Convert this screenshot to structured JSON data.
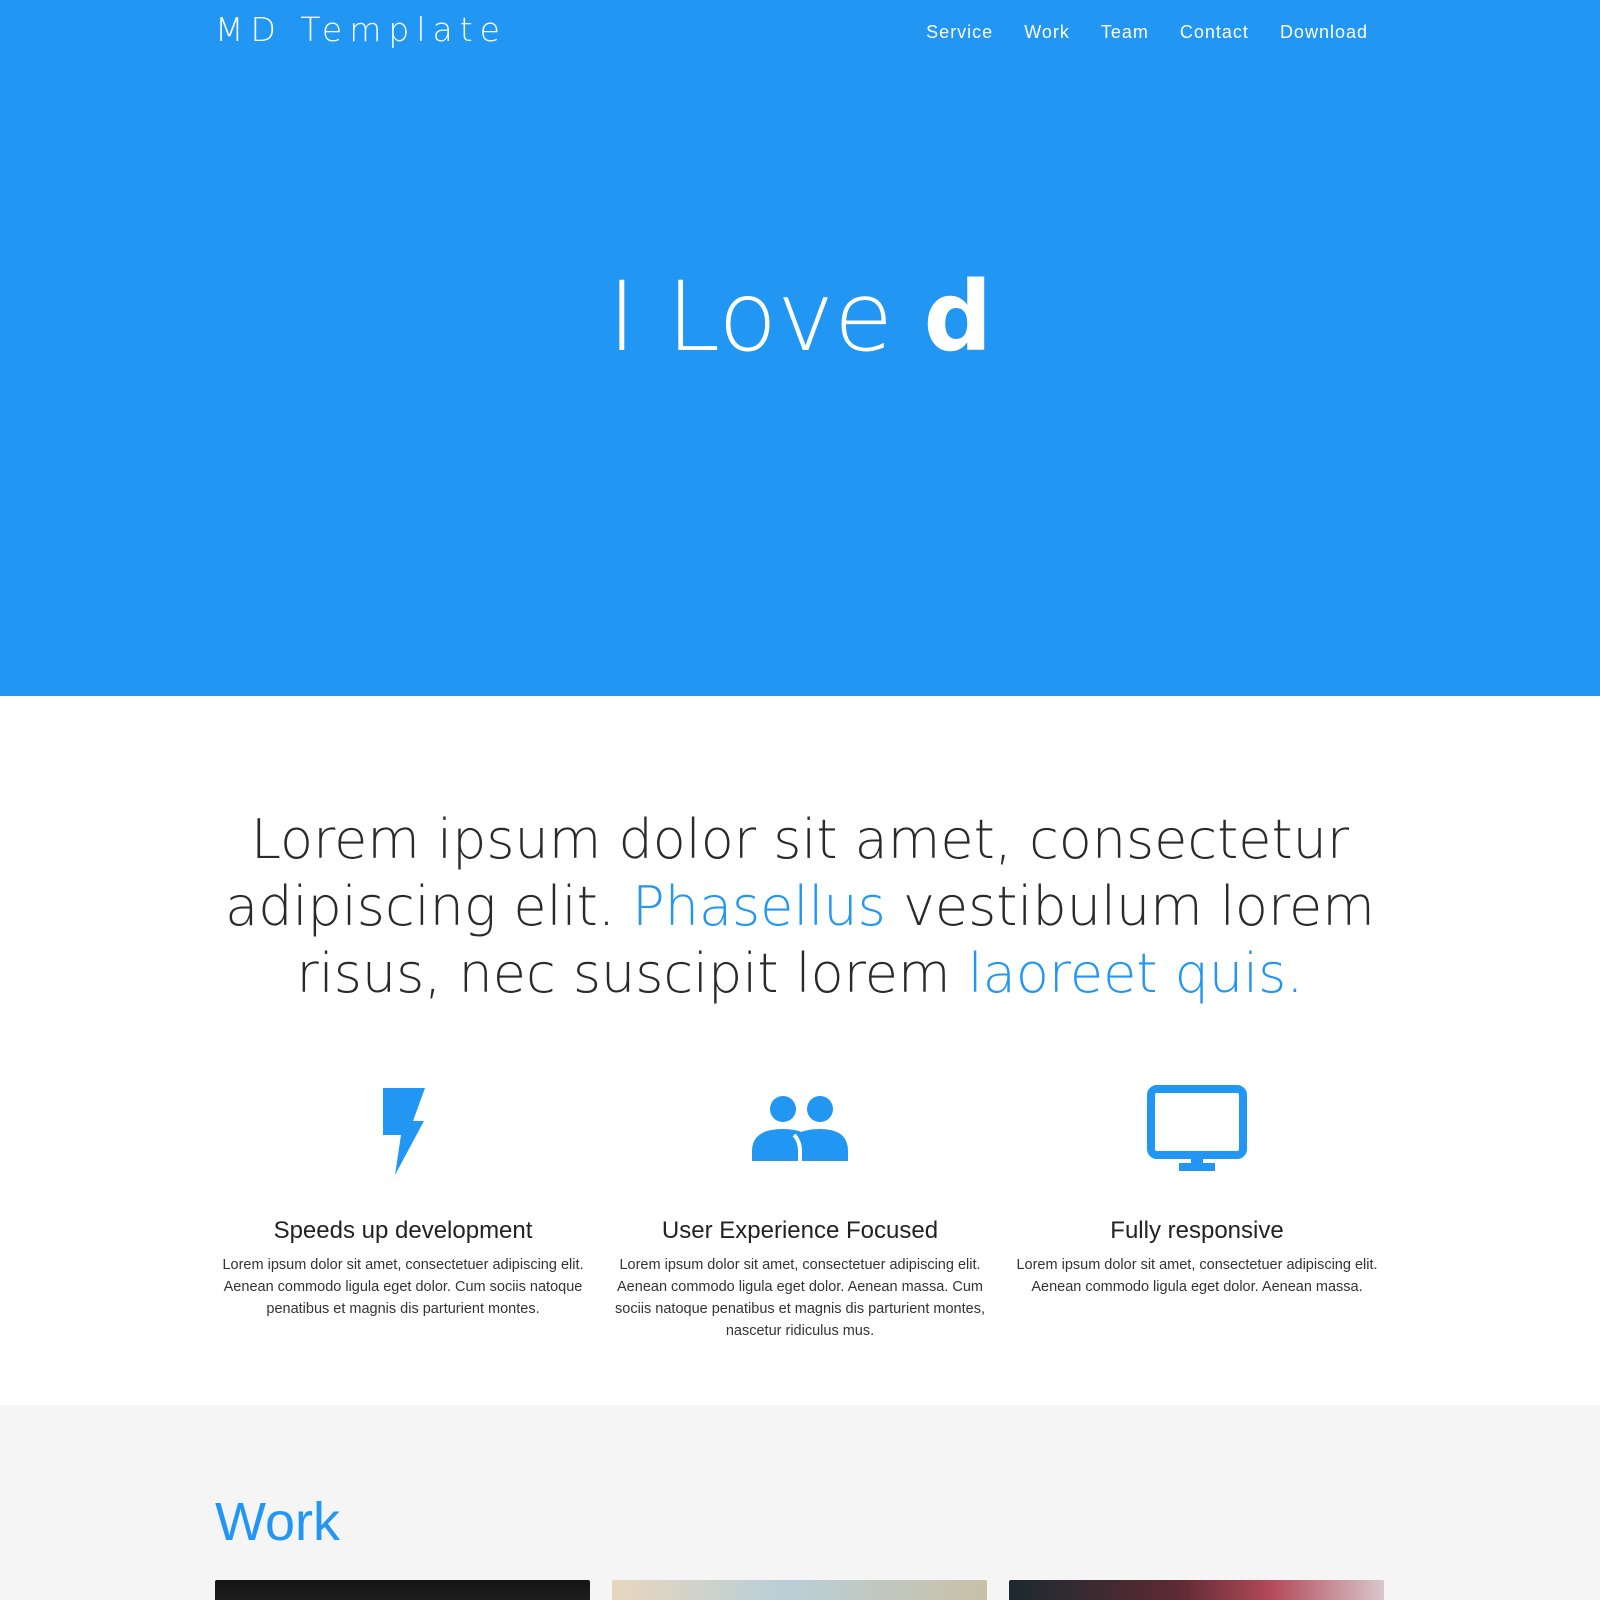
{
  "header": {
    "brand": "MD Template",
    "nav": [
      "Service",
      "Work",
      "Team",
      "Contact",
      "Download"
    ]
  },
  "hero": {
    "title_light": "I Love ",
    "title_bold": "d"
  },
  "intro": {
    "part1": "Lorem ipsum dolor sit amet, consectetur adipiscing elit. ",
    "highlight1": "Phasellus",
    "part2": " vestibulum lorem risus, nec suscipit lorem ",
    "highlight2": "laoreet quis."
  },
  "features": [
    {
      "icon": "lightning-bolt-icon",
      "title": "Speeds up development",
      "text": "Lorem ipsum dolor sit amet, consectetuer adipiscing elit. Aenean commodo ligula eget dolor. Cum sociis natoque penatibus et magnis dis parturient montes."
    },
    {
      "icon": "people-group-icon",
      "title": "User Experience Focused",
      "text": "Lorem ipsum dolor sit amet, consectetuer adipiscing elit. Aenean commodo ligula eget dolor. Aenean massa. Cum sociis natoque penatibus et magnis dis parturient montes, nascetur ridiculus mus."
    },
    {
      "icon": "desktop-monitor-icon",
      "title": "Fully responsive",
      "text": "Lorem ipsum dolor sit amet, consectetuer adipiscing elit. Aenean commodo ligula eget dolor. Aenean massa."
    }
  ],
  "work": {
    "title": "Work"
  },
  "colors": {
    "primary": "#2196F3",
    "section_bg": "#f5f5f5",
    "text": "#222222"
  }
}
